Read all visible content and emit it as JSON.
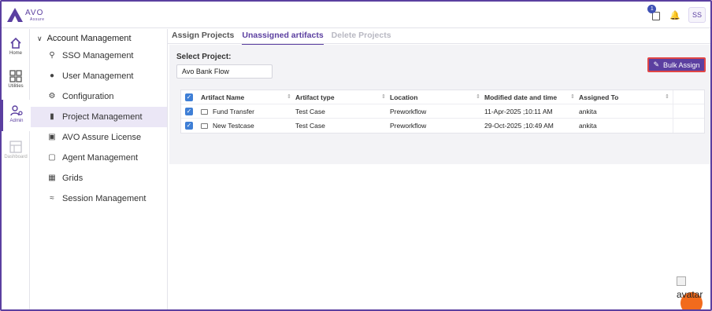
{
  "app": {
    "brand": "AVO",
    "brand_sub": "Assure",
    "accent": "#5b3fa0"
  },
  "topbar": {
    "task_count": "1",
    "user_initials": "SS",
    "icons": [
      "task-icon",
      "bell-icon"
    ]
  },
  "rail": {
    "items": [
      {
        "label": "Home",
        "icon": "home-icon"
      },
      {
        "label": "Utilities",
        "icon": "grid-icon"
      },
      {
        "label": "Admin",
        "icon": "admin-icon"
      },
      {
        "label": "Dashboard",
        "icon": "dashboard-icon"
      }
    ]
  },
  "sidebar": {
    "section_title": "Account Management",
    "items": [
      {
        "label": "SSO Management",
        "icon": "key-icon"
      },
      {
        "label": "User Management",
        "icon": "user-icon"
      },
      {
        "label": "Configuration",
        "icon": "gear-icon"
      },
      {
        "label": "Project Management",
        "icon": "document-icon"
      },
      {
        "label": "AVO Assure License",
        "icon": "license-icon"
      },
      {
        "label": "Agent Management",
        "icon": "monitor-icon"
      },
      {
        "label": "Grids",
        "icon": "grid-icon"
      },
      {
        "label": "Session Management",
        "icon": "session-icon"
      }
    ]
  },
  "tabs": [
    {
      "label": "Assign Projects"
    },
    {
      "label": "Unassigned artifacts"
    },
    {
      "label": "Delete Projects"
    }
  ],
  "form": {
    "select_label": "Select Project:",
    "select_value": "Avo Bank Flow",
    "bulk_assign_label": "Bulk Assign"
  },
  "table": {
    "columns": [
      "Artifact Name",
      "Artifact type",
      "Location",
      "Modified date and time",
      "Assigned To"
    ],
    "rows": [
      {
        "name": "Fund Transfer",
        "type": "Test Case",
        "location": "Preworkflow",
        "modified": "11-Apr-2025 ;10:11 AM",
        "assigned": "ankita"
      },
      {
        "name": "New Testcase",
        "type": "Test Case",
        "location": "Preworkflow",
        "modified": "29-Oct-2025 ;10:49 AM",
        "assigned": "ankita"
      }
    ]
  },
  "footer": {
    "avatar_alt": "avatar"
  }
}
